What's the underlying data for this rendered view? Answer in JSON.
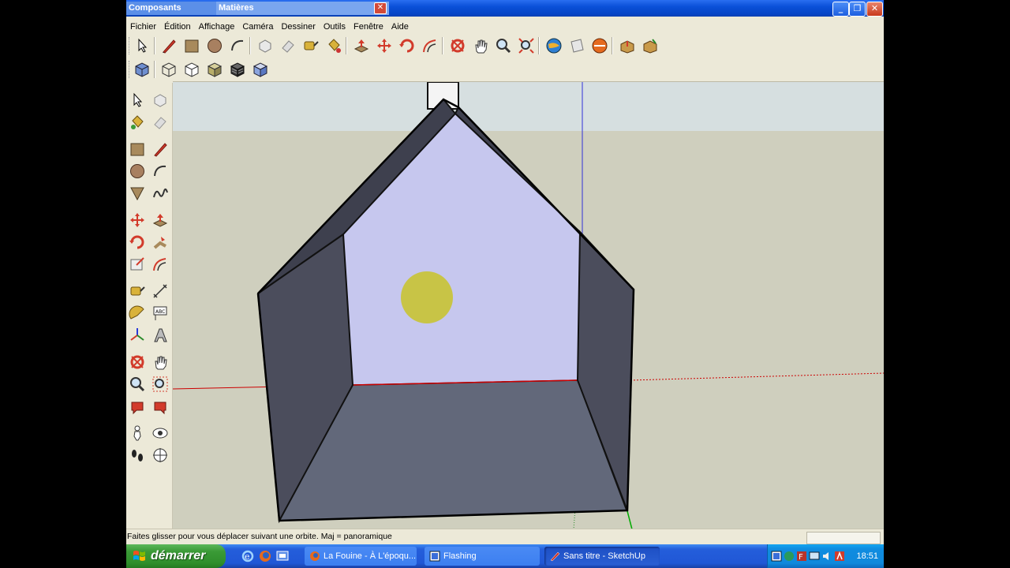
{
  "titlebar": {
    "tab_components": "Composants",
    "tab_materials": "Matières",
    "close_tab": "✕"
  },
  "window_buttons": {
    "minimize": "_",
    "restore": "❐",
    "close": "✕"
  },
  "menu": [
    "Fichier",
    "Édition",
    "Affichage",
    "Caméra",
    "Dessiner",
    "Outils",
    "Fenêtre",
    "Aide"
  ],
  "statusbar": {
    "hint": "Faites glisser pour vous déplacer suivant une orbite.  Maj = panoramique"
  },
  "taskbar": {
    "start_label": "démarrer",
    "tasks": [
      {
        "label": "La Fouine - À L'époqu...",
        "icon": "firefox-icon"
      },
      {
        "label": "Flashing",
        "icon": "app-icon"
      },
      {
        "label": "Sans titre - SketchUp",
        "icon": "sketchup-icon"
      }
    ],
    "clock": "18:51"
  },
  "colors": {
    "titlebar": "#0a50d8",
    "sky": "#d8e1e1",
    "ground": "#cfcfbe",
    "back_wall": "#c6c7ee",
    "floor": "#62687a",
    "side_wall": "#4b4d5c",
    "sun": "#c8c43c",
    "red_axis": "#cc0000",
    "green_axis": "#00aa00",
    "blue_axis": "#3030d8"
  }
}
